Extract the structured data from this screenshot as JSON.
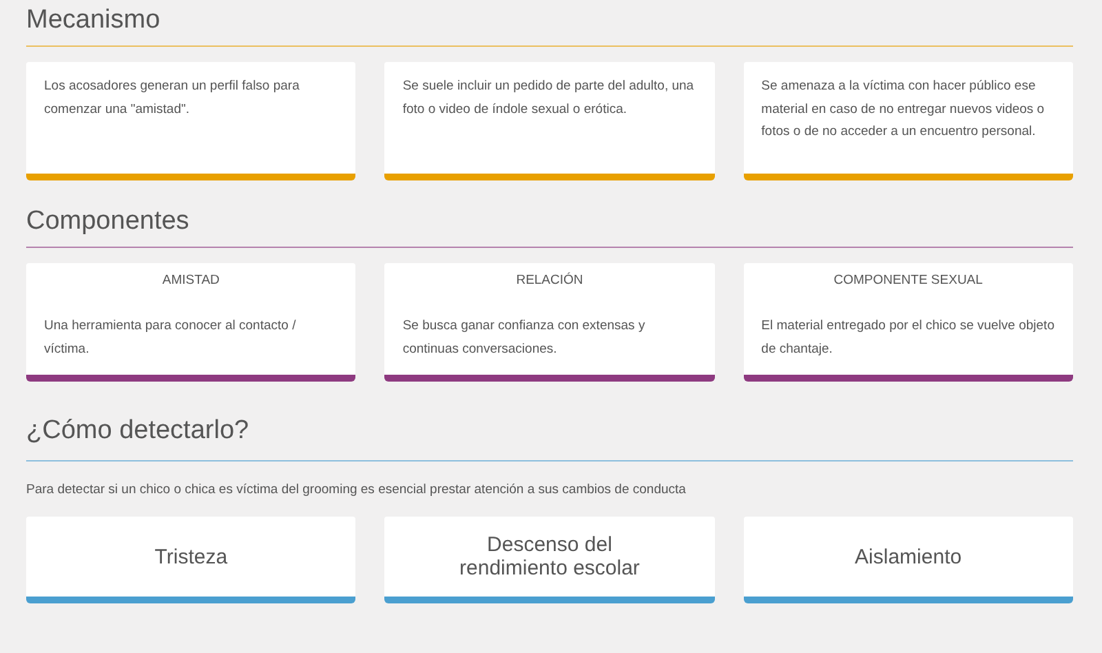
{
  "sections": [
    {
      "title": "Mecanismo",
      "color": "#e8a000",
      "kind": "text",
      "cards": [
        {
          "text": "Los acosadores generan un perfil falso para comenzar una \"amistad\"."
        },
        {
          "text": "Se suele incluir un pedido de parte del adulto, una foto o video de índole sexual o erótica."
        },
        {
          "text": "Se amenaza a la víctima con hacer público ese material en caso de no entregar nuevos videos o fotos o de no acceder a un encuentro personal."
        }
      ]
    },
    {
      "title": "Componentes",
      "color": "#8e3a80",
      "kind": "titled",
      "cards": [
        {
          "heading": "AMISTAD",
          "text": "Una herramienta para conocer al contacto / víctima."
        },
        {
          "heading": "RELACIÓN",
          "text": "Se busca ganar confianza con extensas y continuas conversaciones."
        },
        {
          "heading": "COMPONENTE SEXUAL",
          "text": "El material entregado por el chico se vuelve objeto de chantaje."
        }
      ]
    },
    {
      "title": "¿Cómo detectarlo?",
      "color": "#4a9fd0",
      "kind": "label",
      "intro": "Para detectar si un chico o chica es víctima del grooming es esencial prestar atención a sus cambios de conducta",
      "cards": [
        {
          "label": "Tristeza"
        },
        {
          "label": "Descenso del rendimiento escolar"
        },
        {
          "label": "Aislamiento"
        }
      ]
    }
  ]
}
